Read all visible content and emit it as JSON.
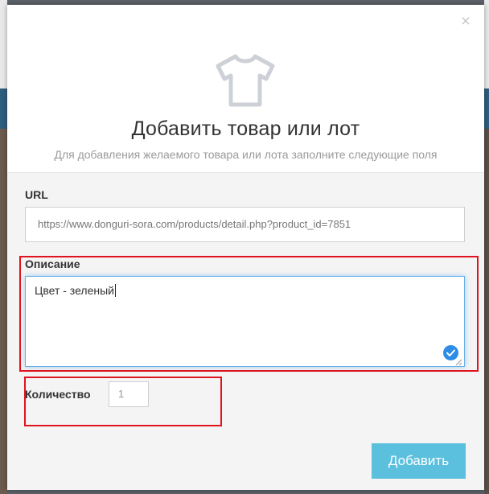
{
  "modal": {
    "close_glyph": "×",
    "icon": "t-shirt-icon",
    "title": "Добавить товар или лот",
    "subtitle": "Для добавления желаемого товара или лота заполните следующие поля"
  },
  "form": {
    "url_label": "URL",
    "url_value": "https://www.donguri-sora.com/products/detail.php?product_id=7851",
    "description_label": "Описание",
    "description_value": "Цвет - зеленый",
    "quantity_label": "Количество",
    "quantity_value": "1",
    "submit_label": "Добавить"
  },
  "colors": {
    "accent": "#5bc0de",
    "focus": "#66afe9",
    "highlight": "#e0141e",
    "check": "#2d8ce6"
  }
}
